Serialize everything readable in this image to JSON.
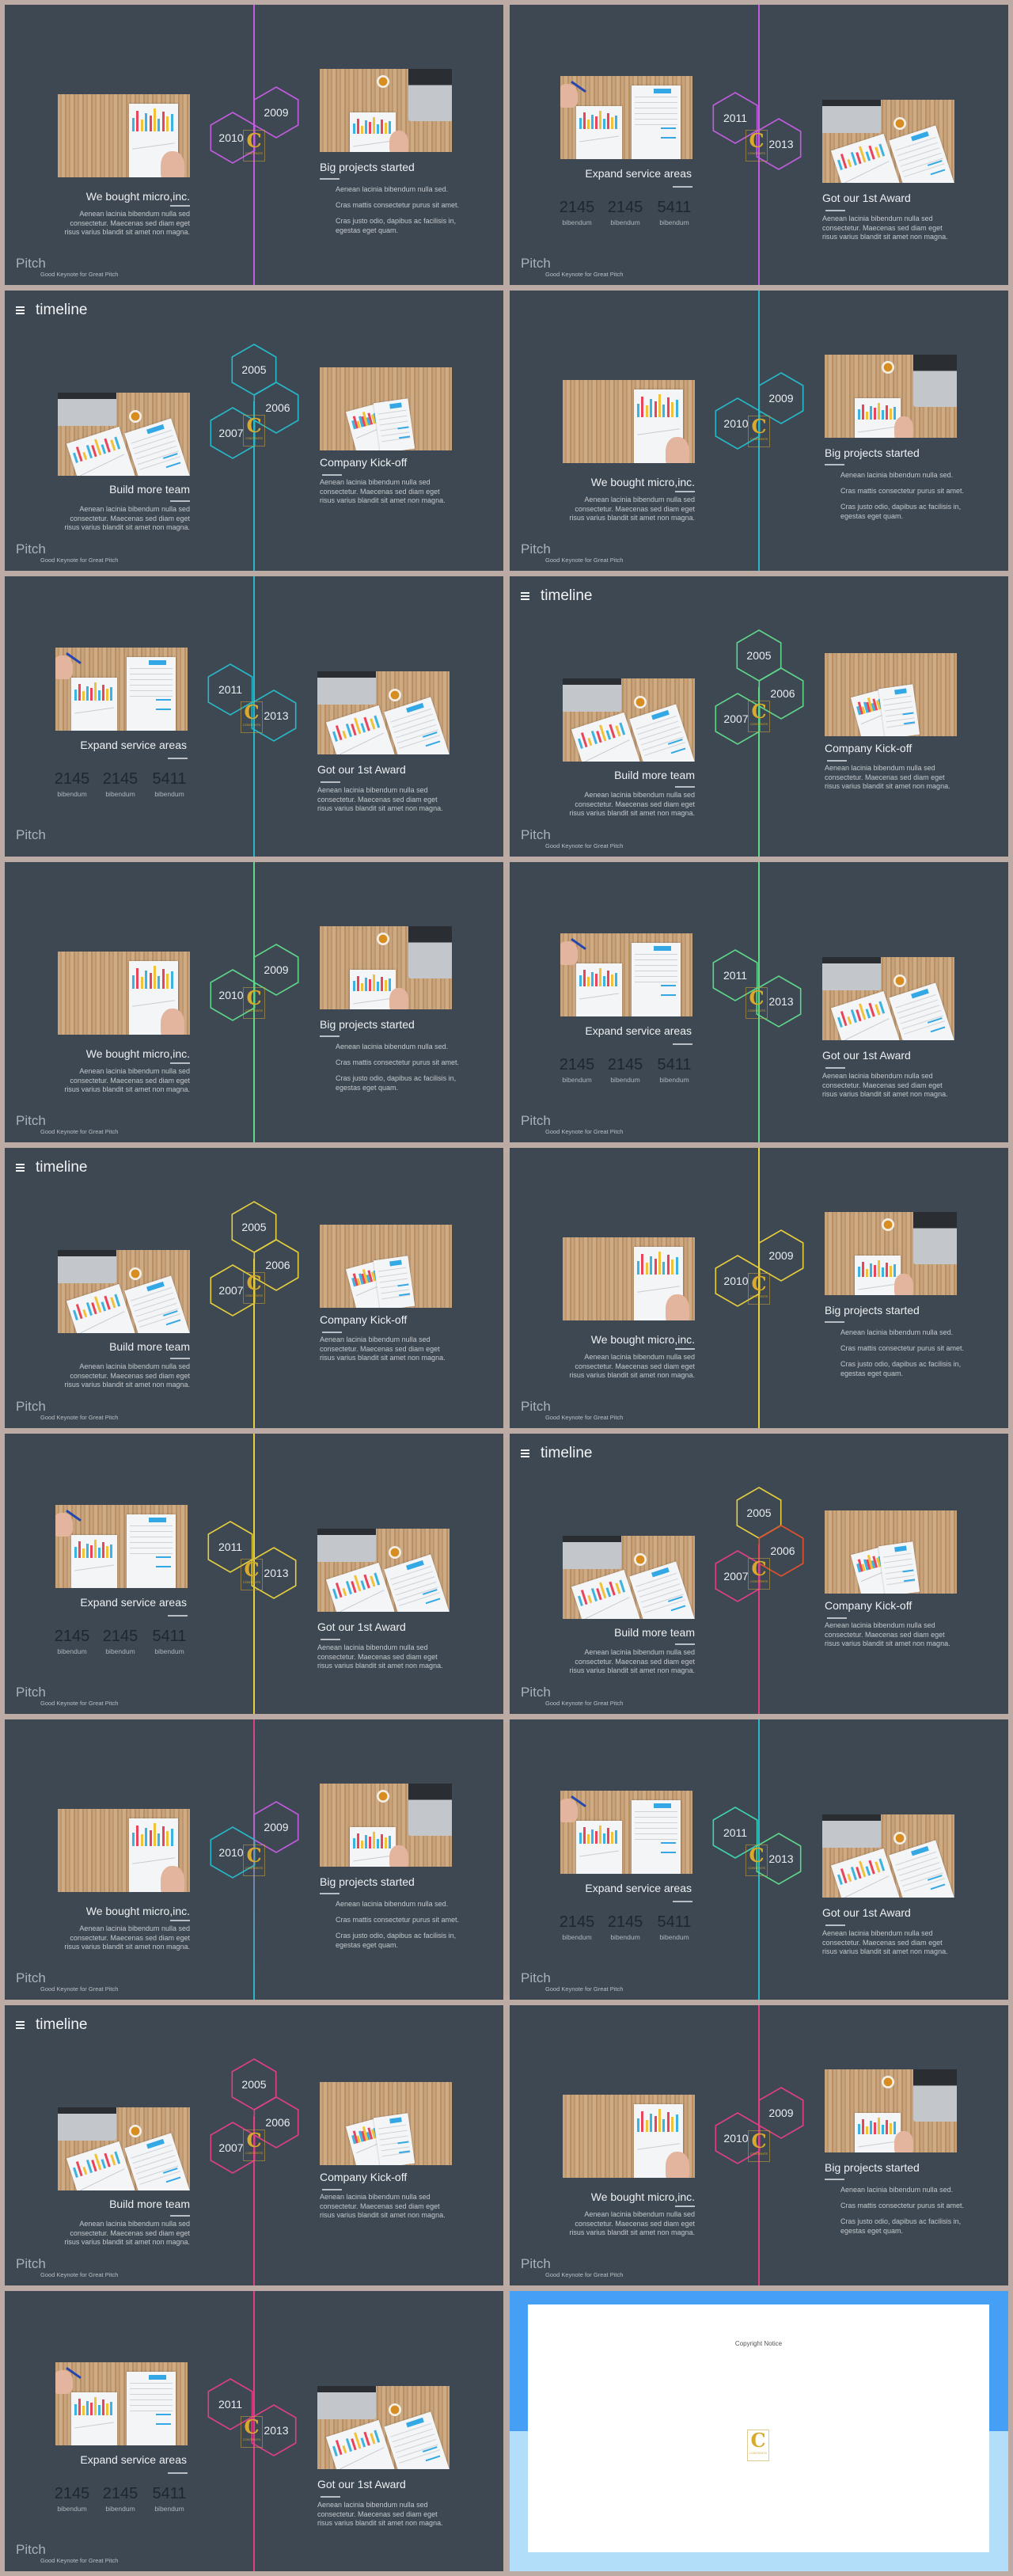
{
  "brand": {
    "pitch_logo": "Pitch",
    "tagline": "Good Keynote for Great Pitch",
    "watermark_logo": "C CONTENTS"
  },
  "colors": {
    "slide_bg": "#3e4852",
    "frame": "#bcaaa4",
    "purple": "#c35ce0",
    "cyan": "#27b9c9",
    "green": "#5fd68a",
    "teal": "#3fd4b2",
    "yellow": "#e6cf3e",
    "orange": "#e0522c",
    "pink": "#df3f87",
    "copyright_top": "#45a0f5",
    "copyright_bottom": "#b3defa"
  },
  "templates": {
    "A": {
      "years": [
        "2009",
        "2010"
      ],
      "left_title": "We bought micro,inc.",
      "left_body": "Aenean lacinia bibendum nulla sed consectetur. Maecenas sed diam eget risus varius blandit sit amet non magna.",
      "right_title": "Big projects started",
      "right_body": [
        "Aenean lacinia bibendum nulla sed.",
        "Cras mattis consectetur purus sit amet.",
        "Cras justo odio, dapibus ac facilisis in, egestas eget quam."
      ]
    },
    "B": {
      "years": [
        "2011",
        "2013"
      ],
      "left_title": "Expand service areas",
      "stats": [
        {
          "value": "2145",
          "label": "bibendum"
        },
        {
          "value": "2145",
          "label": "bibendum"
        },
        {
          "value": "5411",
          "label": "bibendum"
        }
      ],
      "right_title": "Got our 1st Award",
      "right_body": "Aenean lacinia bibendum nulla sed consectetur. Maecenas sed diam eget risus varius blandit sit amet non magna."
    },
    "C": {
      "header": "timeline",
      "header_icon": "hamburger-menu-icon",
      "years": [
        "2005",
        "2006",
        "2007"
      ],
      "left_title": "Build more team",
      "left_body": "Aenean lacinia bibendum nulla sed consectetur. Maecenas sed diam eget risus varius blandit sit amet non magna.",
      "right_title": "Company Kick-off",
      "right_body": "Aenean lacinia bibendum nulla sed consectetur. Maecenas sed diam eget risus varius blandit sit amet non magna."
    }
  },
  "slides": [
    {
      "type": "A",
      "hex_colors": [
        "#c35ce0",
        "#c35ce0"
      ],
      "line": [
        "#c35ce0",
        "#c35ce0"
      ]
    },
    {
      "type": "B",
      "hex_colors": [
        "#c35ce0",
        "#c35ce0"
      ],
      "line": [
        "#c35ce0",
        "#c35ce0"
      ]
    },
    {
      "type": "C",
      "hex_colors": [
        "#27b9c9",
        "#27b9c9",
        "#27b9c9"
      ],
      "line": [
        "#27b9c9",
        "#27b9c9"
      ]
    },
    {
      "type": "A",
      "hex_colors": [
        "#27b9c9",
        "#27b9c9"
      ],
      "line": [
        "#27b9c9",
        "#27b9c9"
      ]
    },
    {
      "type": "B",
      "hex_colors": [
        "#27b9c9",
        "#27b9c9"
      ],
      "line": [
        "#27b9c9",
        "#27b9c9"
      ],
      "show_tagline": false
    },
    {
      "type": "C",
      "hex_colors": [
        "#5fd68a",
        "#5fd68a",
        "#5fd68a"
      ],
      "line": [
        "#5fd68a",
        "#5fd68a"
      ]
    },
    {
      "type": "A",
      "hex_colors": [
        "#5fd68a",
        "#5fd68a"
      ],
      "line": [
        "#5fd68a",
        "#5fd68a"
      ]
    },
    {
      "type": "B",
      "hex_colors": [
        "#5fd68a",
        "#5fd68a"
      ],
      "line": [
        "#5fd68a",
        "#5fd68a"
      ]
    },
    {
      "type": "C",
      "hex_colors": [
        "#e6cf3e",
        "#e6cf3e",
        "#e6cf3e"
      ],
      "line": [
        "#e6cf3e",
        "#e6cf3e"
      ]
    },
    {
      "type": "A",
      "hex_colors": [
        "#e6cf3e",
        "#e6cf3e"
      ],
      "line": [
        "#e6cf3e",
        "#e6cf3e"
      ]
    },
    {
      "type": "B",
      "hex_colors": [
        "#e6cf3e",
        "#e6cf3e"
      ],
      "line": [
        "#e6cf3e",
        "#e6cf3e"
      ]
    },
    {
      "type": "C",
      "hex_colors": [
        "#e6cf3e",
        "#e0522c",
        "#df3f87"
      ],
      "line": [
        "#df3f87",
        "#df3f87"
      ]
    },
    {
      "type": "A",
      "hex_colors": [
        "#c35ce0",
        "#27b9c9"
      ],
      "line": [
        "#df3f87",
        "#27b9c9"
      ]
    },
    {
      "type": "B",
      "hex_colors": [
        "#3fd4b2",
        "#5fd68a"
      ],
      "line": [
        "#27b9c9",
        "#27b9c9"
      ]
    },
    {
      "type": "C",
      "hex_colors": [
        "#df3f87",
        "#df3f87",
        "#df3f87"
      ],
      "line": [
        "#df3f87",
        "#df3f87"
      ]
    },
    {
      "type": "A",
      "hex_colors": [
        "#df3f87",
        "#df3f87"
      ],
      "line": [
        "#df3f87",
        "#df3f87"
      ]
    },
    {
      "type": "B",
      "hex_colors": [
        "#df3f87",
        "#df3f87"
      ],
      "line": [
        "#df3f87",
        "#df3f87"
      ]
    },
    {
      "type": "copyright",
      "text": "Copyright Notice"
    }
  ]
}
